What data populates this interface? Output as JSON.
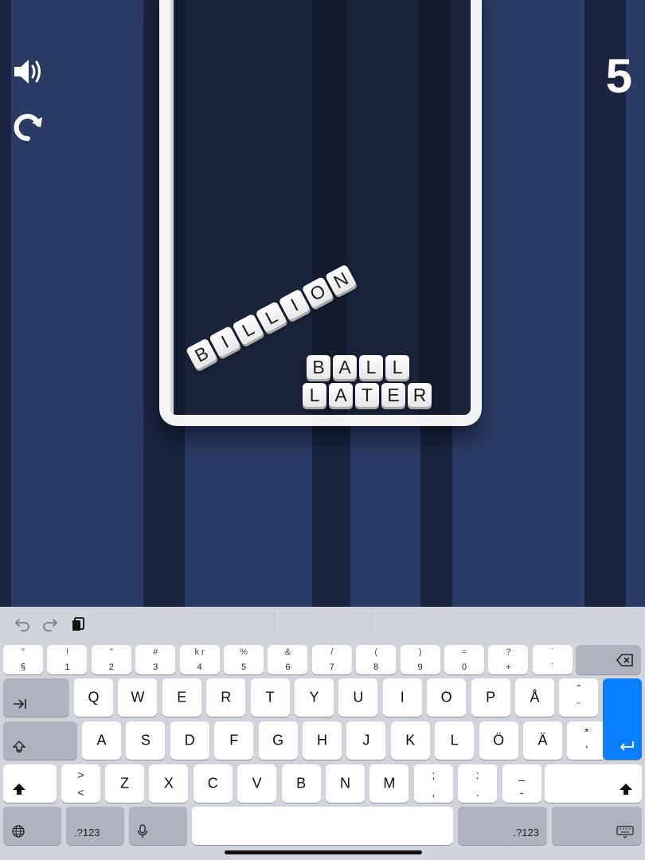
{
  "game": {
    "score": "5",
    "words": {
      "billion": [
        "B",
        "I",
        "L",
        "L",
        "I",
        "O",
        "N"
      ],
      "ball": [
        "B",
        "A",
        "L",
        "L"
      ],
      "later": [
        "L",
        "A",
        "T",
        "E",
        "R"
      ]
    },
    "icons": {
      "sound": "speaker-icon",
      "restart": "restart-icon"
    }
  },
  "keyboard": {
    "toolbar": [
      "undo-icon",
      "redo-icon",
      "clipboard-icon"
    ],
    "number_row": [
      {
        "t": "°",
        "b": "§"
      },
      {
        "t": "!",
        "b": "1"
      },
      {
        "t": "\"",
        "b": "2"
      },
      {
        "t": "#",
        "b": "3"
      },
      {
        "t": "k r",
        "b": "4"
      },
      {
        "t": "%",
        "b": "5"
      },
      {
        "t": "&",
        "b": "6"
      },
      {
        "t": "/",
        "b": "7"
      },
      {
        "t": "(",
        "b": "8"
      },
      {
        "t": ")",
        "b": "9"
      },
      {
        "t": "=",
        "b": "0"
      },
      {
        "t": "?",
        "b": "+"
      },
      {
        "t": "`",
        "b": "´"
      }
    ],
    "row1": [
      "Q",
      "W",
      "E",
      "R",
      "T",
      "Y",
      "U",
      "I",
      "O",
      "P",
      "Å"
    ],
    "row1_extra": {
      "t": "ˆ",
      "b": "¨"
    },
    "row2": [
      "A",
      "S",
      "D",
      "F",
      "G",
      "H",
      "J",
      "K",
      "L",
      "Ö",
      "Ä"
    ],
    "row2_extra": {
      "t": "*",
      "b": "'"
    },
    "row3_pre": {
      "t": ">",
      "b": "<"
    },
    "row3": [
      "Z",
      "X",
      "C",
      "V",
      "B",
      "N",
      "M"
    ],
    "row3_post": [
      {
        "t": ";",
        "b": ","
      },
      {
        "t": ":",
        "b": "."
      },
      {
        "t": "_",
        "b": "-"
      }
    ],
    "num_switch_left": ".?123",
    "num_switch_right": ".?123",
    "colors": {
      "accent": "#0a7cff",
      "key": "#ffffff",
      "dark_key": "#aeb3bd",
      "board": "#d1d4db"
    }
  }
}
